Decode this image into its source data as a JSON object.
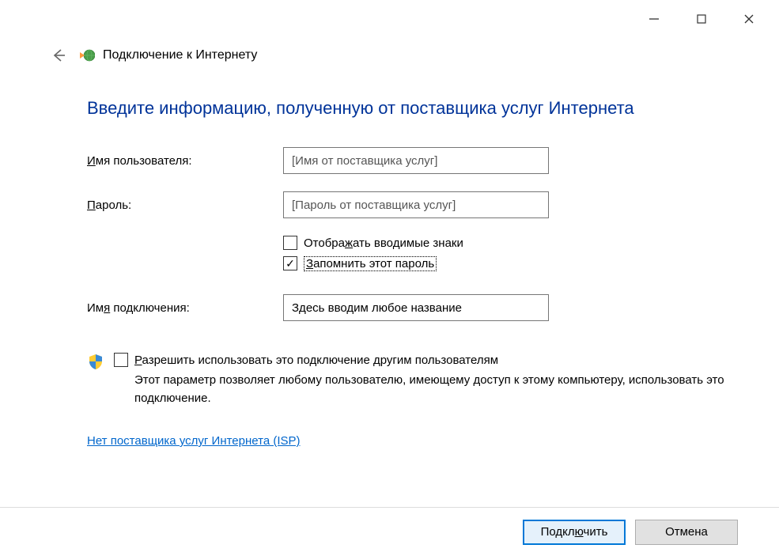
{
  "titlebar": {},
  "header": {
    "title": "Подключение к Интернету"
  },
  "content": {
    "heading": "Введите информацию, полученную от поставщика услуг Интернета",
    "username_label_pre": "И",
    "username_label_rest": "мя пользователя:",
    "username_placeholder": "[Имя от поставщика услуг]",
    "password_label_pre": "П",
    "password_label_rest": "ароль:",
    "password_placeholder": "[Пароль от поставщика услуг]",
    "show_chars_pre": "Отобра",
    "show_chars_ul": "ж",
    "show_chars_rest": "ать вводимые знаки",
    "remember_pre": "З",
    "remember_rest": "апомнить этот пароль",
    "conn_name_label": "Им",
    "conn_name_ul": "я",
    "conn_name_rest": " подключения:",
    "conn_name_value": "Здесь вводим любое название",
    "share_pre": "Р",
    "share_rest": "азрешить использовать это подключение другим пользователям",
    "share_desc": "Этот параметр позволяет любому пользователю, имеющему доступ к этому компьютеру, использовать это подключение.",
    "isp_link": "Нет поставщика услуг Интернета (ISP)"
  },
  "footer": {
    "connect_pre": "Подкл",
    "connect_ul": "ю",
    "connect_rest": "чить",
    "cancel": "Отмена"
  }
}
